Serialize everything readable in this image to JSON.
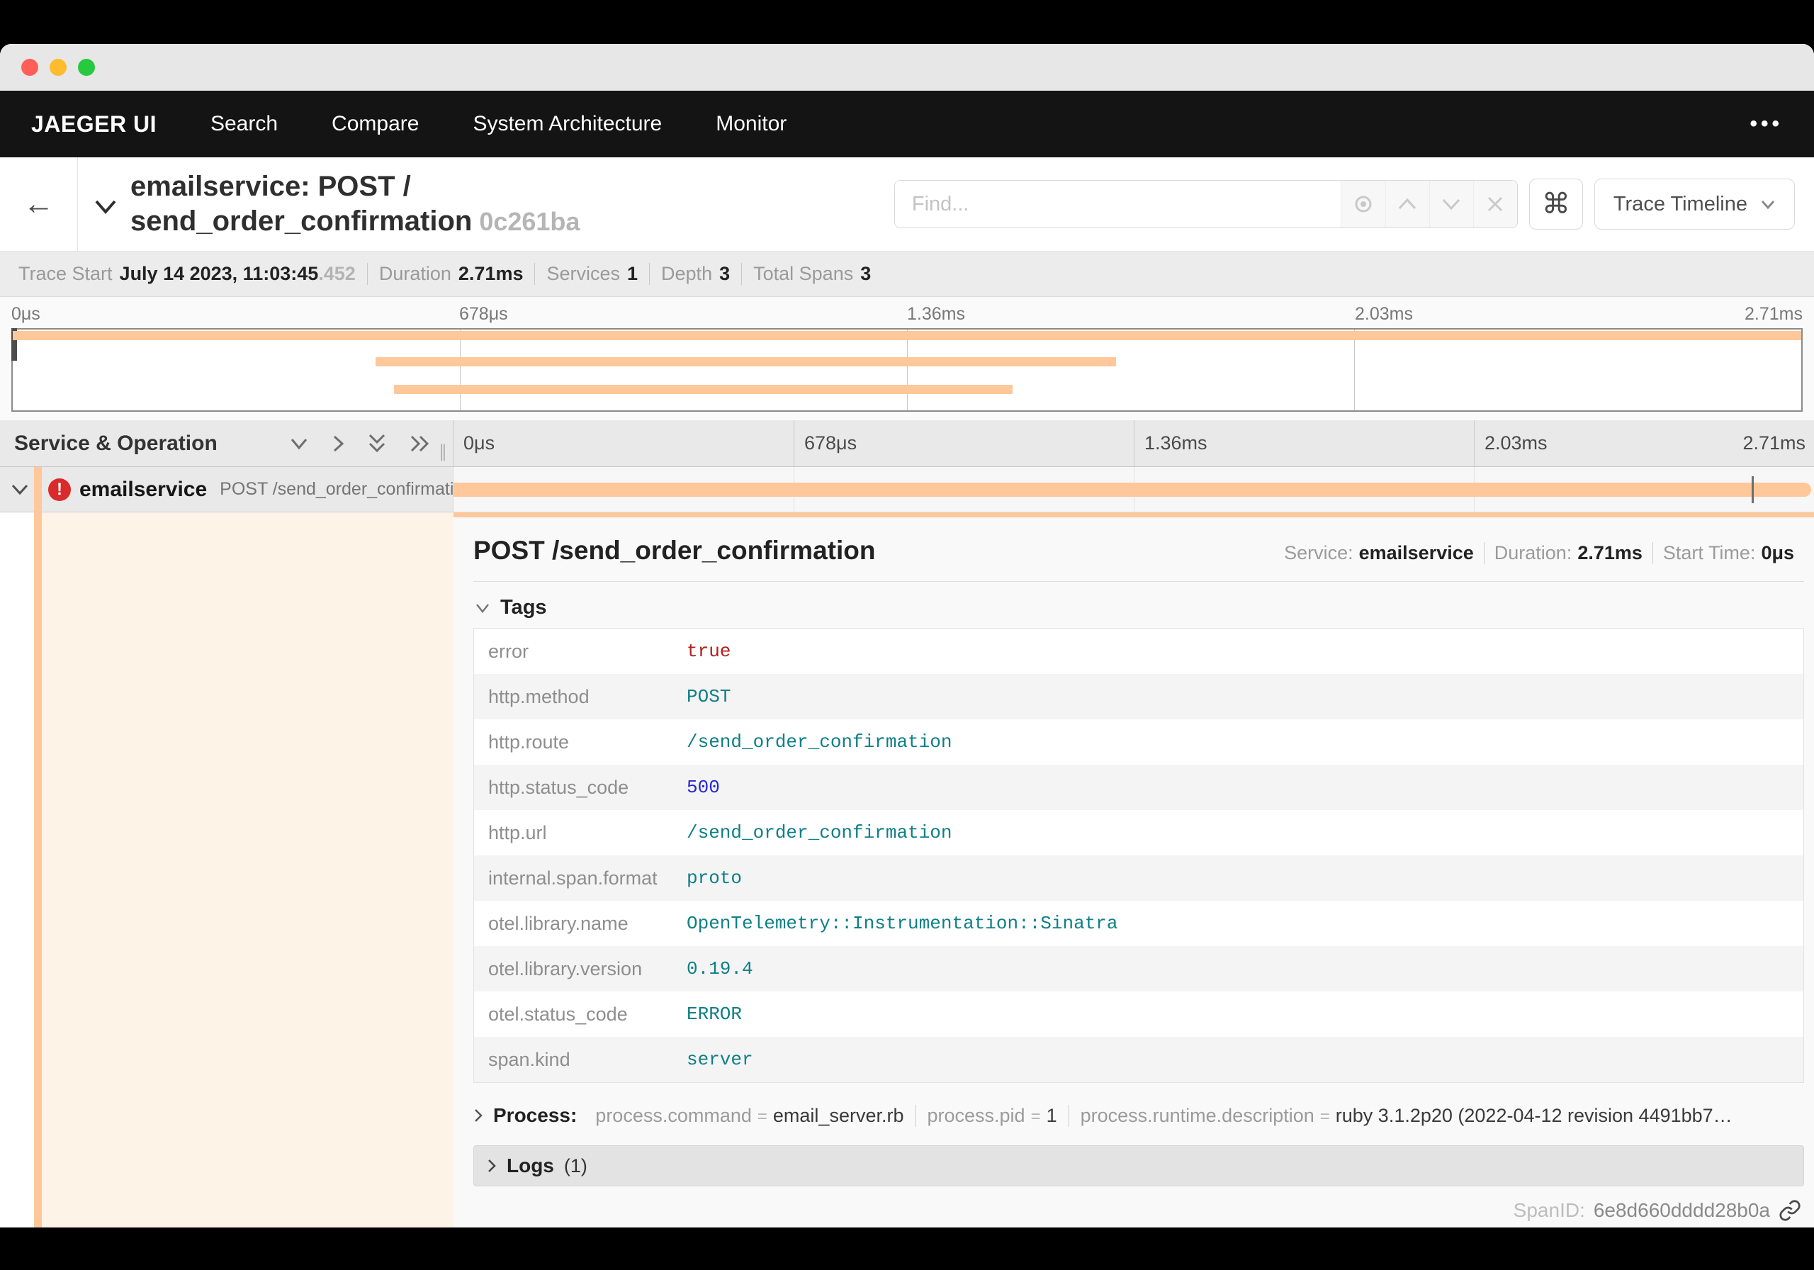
{
  "colors": {
    "accent": "#ffc89b",
    "error_badge": "#db2a2a",
    "tag_string": "#0e7f87",
    "tag_number": "#2525dd",
    "tag_bool": "#b32020"
  },
  "navbar": {
    "brand": "JAEGER UI",
    "items": [
      "Search",
      "Compare",
      "System Architecture",
      "Monitor"
    ]
  },
  "trace_header": {
    "title_line1": "emailservice: POST /",
    "title_line2": "send_order_confirmation",
    "trace_id": "0c261ba",
    "find_placeholder": "Find...",
    "cmd_glyph": "⌘",
    "view_selector": "Trace Timeline"
  },
  "meta": {
    "items": [
      {
        "label": "Trace Start",
        "value": "July 14 2023, 11:03:45",
        "suffix": ".452"
      },
      {
        "label": "Duration",
        "value": "2.71ms"
      },
      {
        "label": "Services",
        "value": "1"
      },
      {
        "label": "Depth",
        "value": "3"
      },
      {
        "label": "Total Spans",
        "value": "3"
      }
    ]
  },
  "timeline": {
    "ticks": [
      "0μs",
      "678μs",
      "1.36ms",
      "2.03ms",
      "2.71ms"
    ],
    "left_header": "Service & Operation",
    "minimap_bars": [
      {
        "left": 0,
        "width": 100
      },
      {
        "left": 20.3,
        "width": 41.4
      },
      {
        "left": 21.3,
        "width": 34.6
      }
    ],
    "minimap_bar_tops": [
      2,
      39,
      78
    ]
  },
  "span_row": {
    "service": "emailservice",
    "operation": "POST /send_order_confirmation",
    "bar": {
      "left": 0,
      "width": 99.8
    },
    "tick_pos": 95.4
  },
  "detail": {
    "title": "POST /send_order_confirmation",
    "summary": [
      {
        "label": "Service:",
        "value": "emailservice"
      },
      {
        "label": "Duration:",
        "value": "2.71ms"
      },
      {
        "label": "Start Time:",
        "value": "0μs"
      }
    ],
    "tags_header": "Tags",
    "tags": [
      {
        "key": "error",
        "value": "true",
        "type": "bool"
      },
      {
        "key": "http.method",
        "value": "POST",
        "type": "string"
      },
      {
        "key": "http.route",
        "value": "/send_order_confirmation",
        "type": "string"
      },
      {
        "key": "http.status_code",
        "value": "500",
        "type": "number"
      },
      {
        "key": "http.url",
        "value": "/send_order_confirmation",
        "type": "string"
      },
      {
        "key": "internal.span.format",
        "value": "proto",
        "type": "string"
      },
      {
        "key": "otel.library.name",
        "value": "OpenTelemetry::Instrumentation::Sinatra",
        "type": "string"
      },
      {
        "key": "otel.library.version",
        "value": "0.19.4",
        "type": "string"
      },
      {
        "key": "otel.status_code",
        "value": "ERROR",
        "type": "string"
      },
      {
        "key": "span.kind",
        "value": "server",
        "type": "string"
      }
    ],
    "process_label": "Process:",
    "process_pairs": [
      {
        "key": "process.command",
        "value": "email_server.rb"
      },
      {
        "key": "process.pid",
        "value": "1"
      },
      {
        "key": "process.runtime.description",
        "value": "ruby 3.1.2p20 (2022-04-12 revision 4491bb7…"
      }
    ],
    "logs_label": "Logs",
    "logs_count": "(1)",
    "spanid_label": "SpanID:",
    "spanid_value": "6e8d660dddd28b0a"
  }
}
